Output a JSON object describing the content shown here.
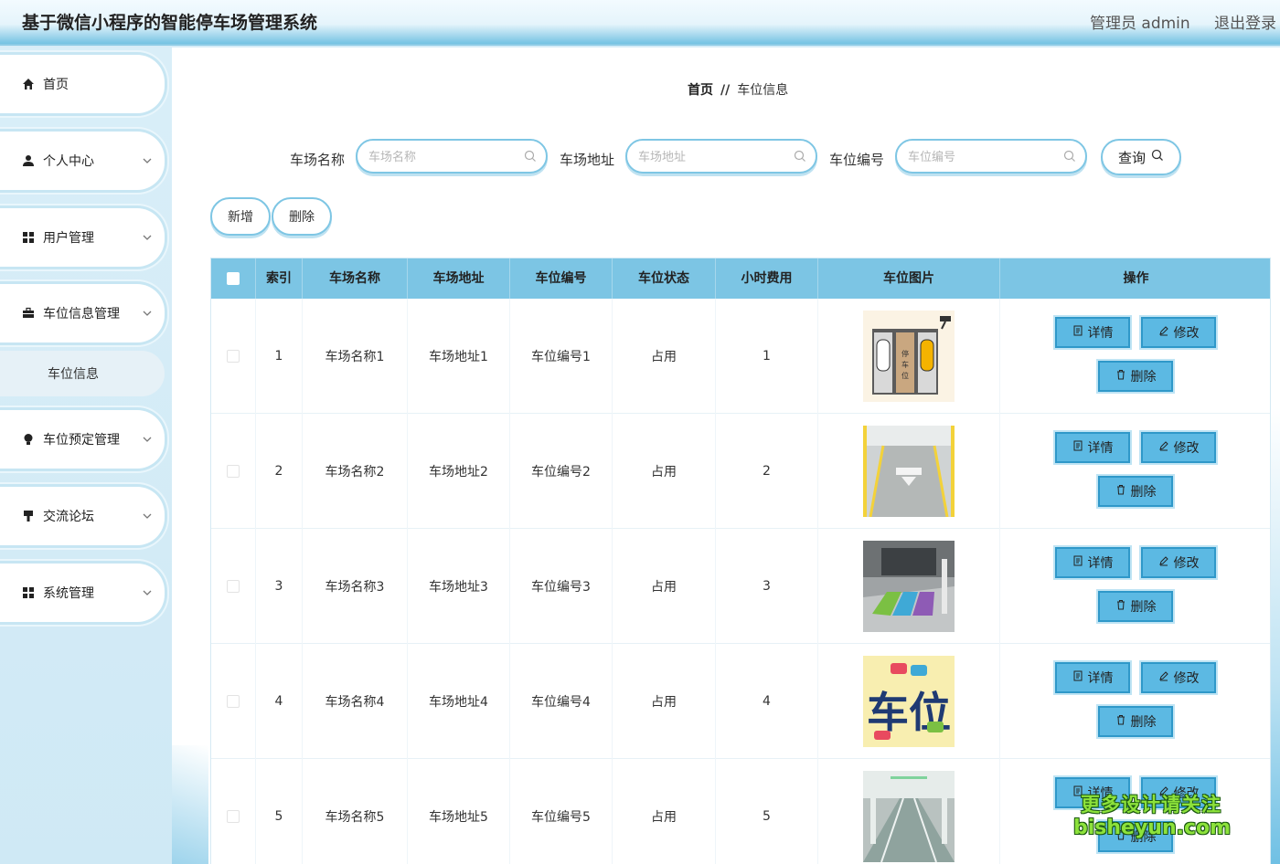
{
  "header": {
    "app_title": "基于微信小程序的智能停车场管理系统",
    "user_info": "管理员 admin",
    "logout": "退出登录"
  },
  "sidebar": {
    "items": [
      {
        "label": "首页",
        "icon": "home-icon",
        "has_arrow": false
      },
      {
        "label": "个人中心",
        "icon": "user-icon",
        "has_arrow": true
      },
      {
        "label": "用户管理",
        "icon": "grid-icon",
        "has_arrow": true
      },
      {
        "label": "车位信息管理",
        "icon": "briefcase-icon",
        "has_arrow": true
      },
      {
        "label": "车位预定管理",
        "icon": "bulb-icon",
        "has_arrow": true
      },
      {
        "label": "交流论坛",
        "icon": "sign-icon",
        "has_arrow": true
      },
      {
        "label": "系统管理",
        "icon": "grid-icon",
        "has_arrow": true
      }
    ],
    "sub_item": "车位信息"
  },
  "breadcrumb": {
    "home": "首页",
    "separator": "//",
    "current": "车位信息"
  },
  "search": {
    "fields": [
      {
        "label": "车场名称",
        "placeholder": "车场名称"
      },
      {
        "label": "车场地址",
        "placeholder": "车场地址"
      },
      {
        "label": "车位编号",
        "placeholder": "车位编号"
      }
    ],
    "query_label": "查询"
  },
  "actions": {
    "add": "新增",
    "delete": "删除"
  },
  "table": {
    "columns": [
      "索引",
      "车场名称",
      "车场地址",
      "车位编号",
      "车位状态",
      "小时费用",
      "车位图片",
      "操作"
    ],
    "rows": [
      {
        "index": "1",
        "name": "车场名称1",
        "address": "车场地址1",
        "number": "车位编号1",
        "status": "占用",
        "fee": "1"
      },
      {
        "index": "2",
        "name": "车场名称2",
        "address": "车场地址2",
        "number": "车位编号2",
        "status": "占用",
        "fee": "2"
      },
      {
        "index": "3",
        "name": "车场名称3",
        "address": "车场地址3",
        "number": "车位编号3",
        "status": "占用",
        "fee": "3"
      },
      {
        "index": "4",
        "name": "车场名称4",
        "address": "车场地址4",
        "number": "车位编号4",
        "status": "占用",
        "fee": "4"
      },
      {
        "index": "5",
        "name": "车场名称5",
        "address": "车场地址5",
        "number": "车位编号5",
        "status": "占用",
        "fee": "5"
      }
    ],
    "op_labels": {
      "detail": "详情",
      "edit": "修改",
      "delete": "删除"
    }
  },
  "watermark": {
    "line1": "更多设计请关注",
    "line2": "bisheyun.com"
  },
  "colors": {
    "accent": "#7cc5e4",
    "button": "#5cb9e3",
    "sidebar_bg": "#d6ecf7"
  }
}
